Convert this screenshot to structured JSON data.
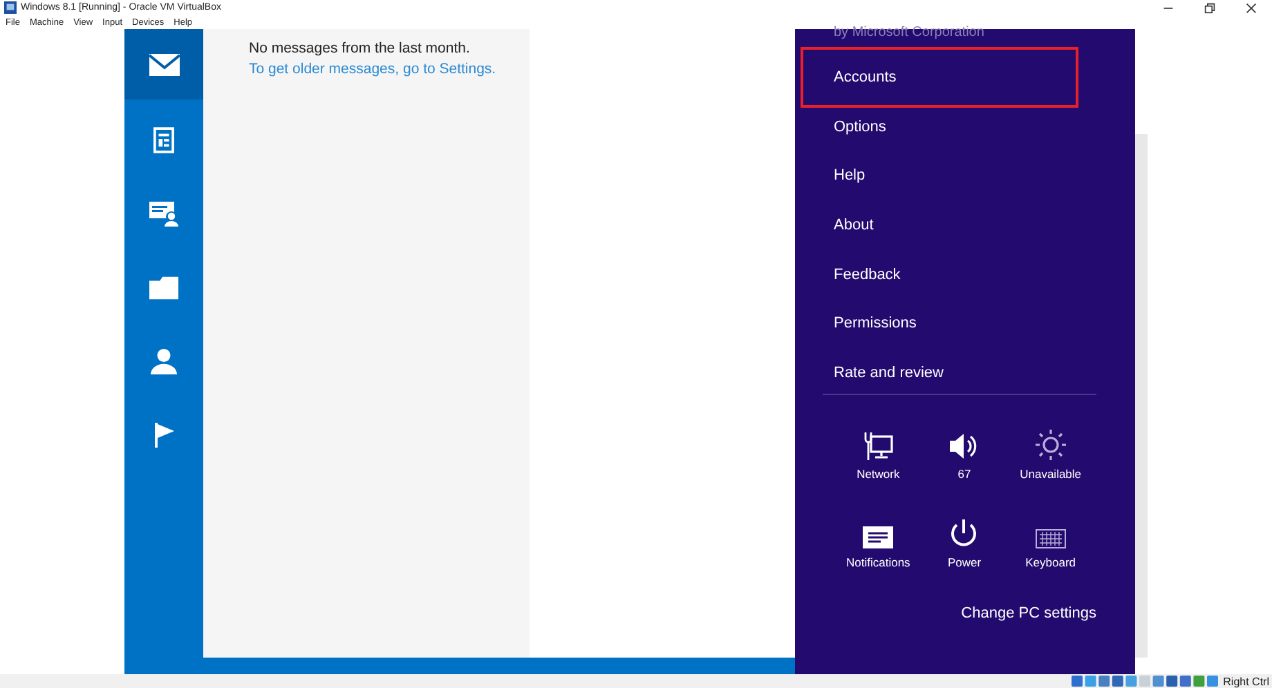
{
  "window": {
    "title": "Windows 8.1 [Running] - Oracle VM VirtualBox",
    "controls": [
      {
        "kind": "minimize"
      },
      {
        "kind": "restore"
      },
      {
        "kind": "close"
      }
    ]
  },
  "menu_bar": [
    "File",
    "Machine",
    "View",
    "Input",
    "Devices",
    "Help"
  ],
  "nav_rail": [
    {
      "kind": "mail",
      "selected": true
    },
    {
      "kind": "newsfeed",
      "selected": false
    },
    {
      "kind": "contact-card",
      "selected": false
    },
    {
      "kind": "folder",
      "selected": false
    },
    {
      "kind": "person",
      "selected": false
    },
    {
      "kind": "flag",
      "selected": false
    }
  ],
  "message_list": {
    "notice": "No messages from the last month.",
    "link": "To get older messages, go to Settings."
  },
  "settings_pane": {
    "publisher": "by Microsoft Corporation",
    "items": [
      {
        "label": "Accounts",
        "highlighted": true
      },
      {
        "label": "Options",
        "highlighted": false
      },
      {
        "label": "Help",
        "highlighted": false
      },
      {
        "label": "About",
        "highlighted": false
      },
      {
        "label": "Feedback",
        "highlighted": false
      },
      {
        "label": "Permissions",
        "highlighted": false
      },
      {
        "label": "Rate and review",
        "highlighted": false
      }
    ],
    "quick_settings": [
      {
        "kind": "network",
        "label": "Network",
        "disabled": false
      },
      {
        "kind": "volume",
        "label": "67",
        "disabled": false
      },
      {
        "kind": "brightness",
        "label": "Unavailable",
        "disabled": true
      },
      {
        "kind": "notifications",
        "label": "Notifications",
        "disabled": false
      },
      {
        "kind": "power",
        "label": "Power",
        "disabled": false
      },
      {
        "kind": "keyboard",
        "label": "Keyboard",
        "disabled": true
      }
    ],
    "footer_link": "Change PC settings"
  },
  "status_bar": {
    "host_key": "Right Ctrl"
  }
}
